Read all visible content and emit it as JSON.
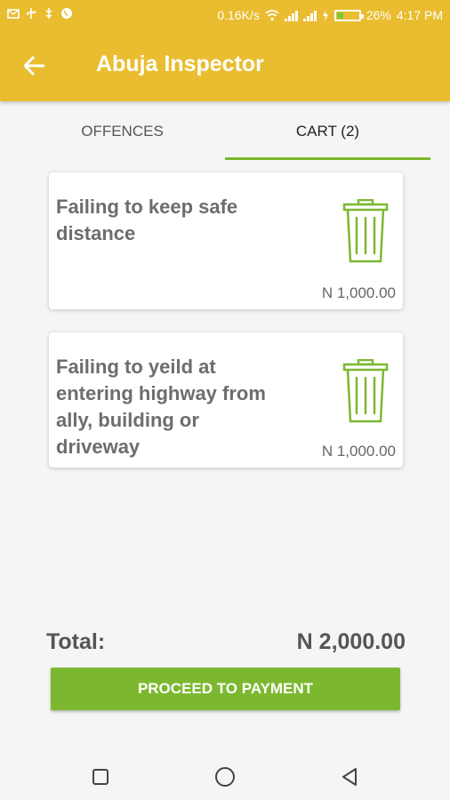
{
  "status_bar": {
    "speed": "0.16K/s",
    "battery_percent": "26%",
    "battery_level": 0.26,
    "time": "4:17 PM"
  },
  "app_bar": {
    "title": "Abuja Inspector"
  },
  "tabs": [
    {
      "label": "OFFENCES",
      "active": false
    },
    {
      "label": "CART (2)",
      "active": true
    }
  ],
  "cart_items": [
    {
      "title": "Failing to keep safe distance",
      "price": "N 1,000.00"
    },
    {
      "title": "Failing to yeild at entering highway from ally, building or driveway",
      "price": "N 1,000.00"
    }
  ],
  "total": {
    "label": "Total:",
    "value": "N 2,000.00"
  },
  "proceed_button": "PROCEED TO PAYMENT",
  "colors": {
    "primary": "#e9bd2f",
    "accent": "#7cb82f"
  }
}
